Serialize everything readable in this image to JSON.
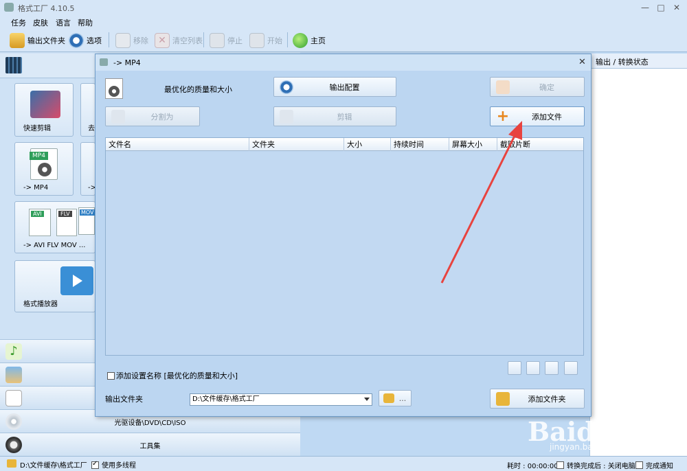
{
  "app": {
    "title": "格式工厂 4.10.5"
  },
  "menu": [
    "任务",
    "皮肤",
    "语言",
    "帮助"
  ],
  "toolbar": {
    "output_folder": "输出文件夹",
    "options": "选项",
    "remove": "移除",
    "clear_list": "清空列表",
    "stop": "停止",
    "start": "开始",
    "home": "主页"
  },
  "left_panel": {
    "tiles": [
      "快速剪辑",
      "去",
      "-> MP4",
      "->",
      "-> AVI FLV MOV ...",
      "格式播放器"
    ],
    "tile_badges": {
      "mp4": "MP4",
      "avi": "AVI",
      "flv": "FLV",
      "mov": "MOV"
    },
    "categories": [
      "",
      "",
      "",
      "光驱设备\\DVD\\CD\\ISO",
      "工具集"
    ]
  },
  "right_panel": {
    "header": "输出 / 转换状态"
  },
  "dialog": {
    "title": "-> MP4",
    "quality_label": "最优化的质量和大小",
    "output_config": "输出配置",
    "ok": "确定",
    "split": "分割为",
    "cut": "剪辑",
    "add_file": "添加文件",
    "columns": [
      "文件名",
      "文件夹",
      "大小",
      "持续时间",
      "屏幕大小",
      "截取片断"
    ],
    "add_setting_name": "添加设置名称 [最优化的质量和大小]",
    "output_folder_label": "输出文件夹",
    "output_folder_value": "D:\\文件缓存\\格式工厂",
    "browse": "...",
    "add_folder": "添加文件夹"
  },
  "statusbar": {
    "path": "D:\\文件缓存\\格式工厂",
    "multithread": "使用多线程",
    "elapsed": "耗时 : 00:00:00",
    "after_convert": "转换完成后 : 关闭电脑",
    "notify": "完成通知"
  },
  "watermark": {
    "main": "Baidu经验",
    "sub": "jingyan.baidu.com"
  },
  "colors": {
    "annotation_arrow": "#e8433f",
    "accent": "#3d7fc4"
  }
}
